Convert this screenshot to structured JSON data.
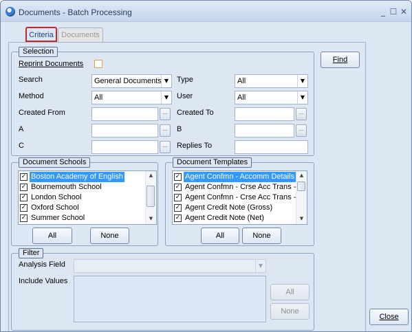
{
  "window": {
    "title": "Documents - Batch Processing",
    "minimize_glyph": "_",
    "maximize_glyph": "☐",
    "close_glyph": "✕",
    "icon": "app-globe-icon"
  },
  "tabs": [
    {
      "label": "Criteria"
    },
    {
      "label": "Documents"
    }
  ],
  "selection": {
    "group_label": "Selection",
    "reprint_label": "Reprint Documents",
    "reprint_checked": false,
    "search_label": "Search",
    "search_value": "General Documents",
    "type_label": "Type",
    "type_value": "All",
    "method_label": "Method",
    "method_value": "All",
    "user_label": "User",
    "user_value": "All",
    "created_from_label": "Created From",
    "created_from_value": "",
    "created_to_label": "Created To",
    "created_to_value": "",
    "a_label": "A",
    "a_value": "",
    "b_label": "B",
    "b_value": "",
    "c_label": "C",
    "c_value": "",
    "replies_to_label": "Replies To",
    "replies_to_value": ""
  },
  "find_label": "Find",
  "schools": {
    "group_label": "Document Schools",
    "items": [
      {
        "label": "Boston Academy of English",
        "checked": true,
        "selected": true
      },
      {
        "label": "Bournemouth School",
        "checked": true,
        "selected": false
      },
      {
        "label": "London School",
        "checked": true,
        "selected": false
      },
      {
        "label": "Oxford School",
        "checked": true,
        "selected": false
      },
      {
        "label": "Summer School",
        "checked": true,
        "selected": false
      }
    ],
    "all_label": "All",
    "none_label": "None"
  },
  "templates": {
    "group_label": "Document Templates",
    "items": [
      {
        "label": "Agent Confmn - Accomm Details",
        "checked": true,
        "selected": true
      },
      {
        "label": "Agent Confmn - Crse Acc Trans -",
        "checked": true,
        "selected": false
      },
      {
        "label": "Agent Confmn - Crse Acc Trans -",
        "checked": true,
        "selected": false
      },
      {
        "label": "Agent Credit Note (Gross)",
        "checked": true,
        "selected": false
      },
      {
        "label": "Agent Credit Note (Net)",
        "checked": true,
        "selected": false
      }
    ],
    "all_label": "All",
    "none_label": "None"
  },
  "filter": {
    "group_label": "Filter",
    "analysis_field_label": "Analysis Field",
    "analysis_field_value": "",
    "include_values_label": "Include Values",
    "all_label": "All",
    "none_label": "None"
  },
  "close_label": "Close",
  "glyphs": {
    "check": "✓",
    "dropdown": "▼",
    "ellipsis": "...",
    "scroll_up": "▲",
    "scroll_down": "▼"
  },
  "colors": {
    "selected_highlight": "#3399ff",
    "active_tab_outline": "#c0282e",
    "window_bg": "#dde7f4"
  }
}
